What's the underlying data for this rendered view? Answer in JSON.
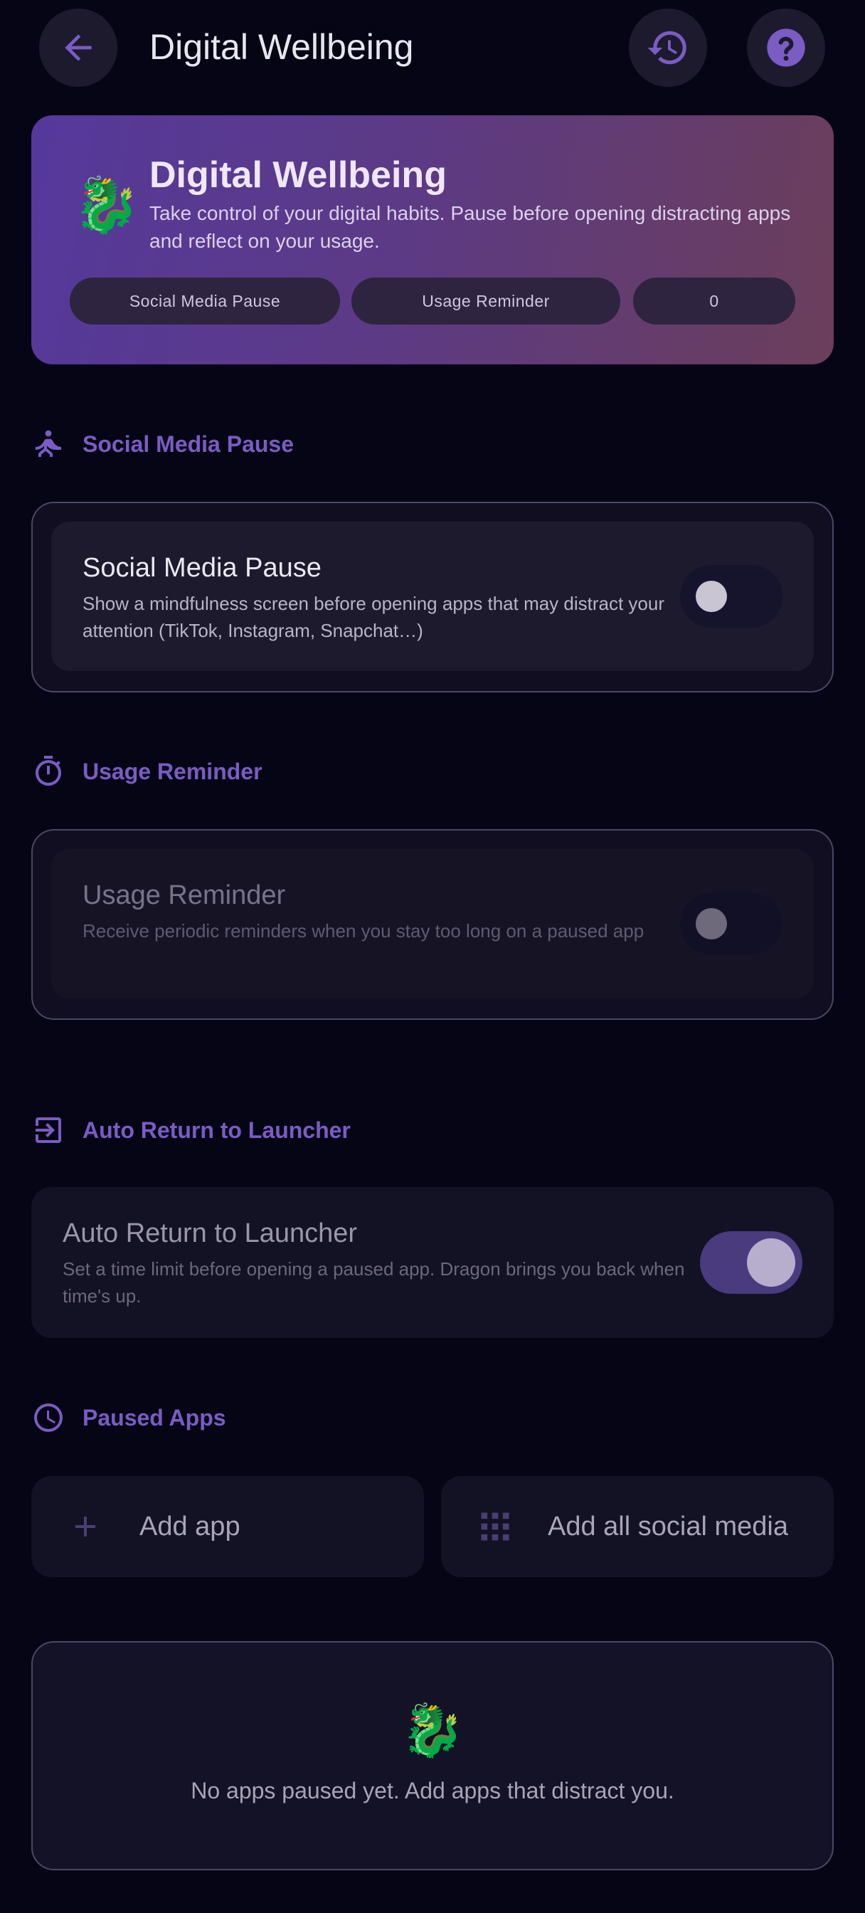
{
  "colors": {
    "background": "#060515",
    "accent": "#7a5cc4",
    "switch_on": "#4a3a7e",
    "switch_off": "#16142c"
  },
  "topbar": {
    "title": "Digital Wellbeing",
    "back_icon": "arrow-left-icon",
    "history_icon": "history-icon",
    "help_icon": "help-icon"
  },
  "hero": {
    "emoji": "🐉",
    "title": "Digital Wellbeing",
    "description": "Take control of your digital habits. Pause before opening distracting apps and reflect on your usage.",
    "chips": [
      "Social Media Pause",
      "Usage Reminder",
      "0"
    ]
  },
  "sections": {
    "social_pause": {
      "header": "Social Media Pause",
      "icon": "meditation-icon",
      "setting_title": "Social Media Pause",
      "setting_desc": "Show a mindfulness screen before opening apps that may distract your attention (TikTok, Instagram, Snapchat…)",
      "enabled": false
    },
    "usage_reminder": {
      "header": "Usage Reminder",
      "icon": "timer-icon",
      "setting_title": "Usage Reminder",
      "setting_desc": "Receive periodic reminders when you stay too long on a paused app",
      "enabled": false,
      "disabled": true
    },
    "auto_return": {
      "header": "Auto Return to Launcher",
      "icon": "exit-to-app-icon",
      "setting_title": "Auto Return to Launcher",
      "setting_desc": "Set a time limit before opening a paused app. Dragon brings you back when time's up.",
      "enabled": true
    },
    "paused_apps": {
      "header": "Paused Apps",
      "icon": "clock-icon",
      "add_app": "Add app",
      "add_all": "Add all social media",
      "empty_emoji": "🐉",
      "empty_text": "No apps paused yet. Add apps that distract you."
    }
  }
}
